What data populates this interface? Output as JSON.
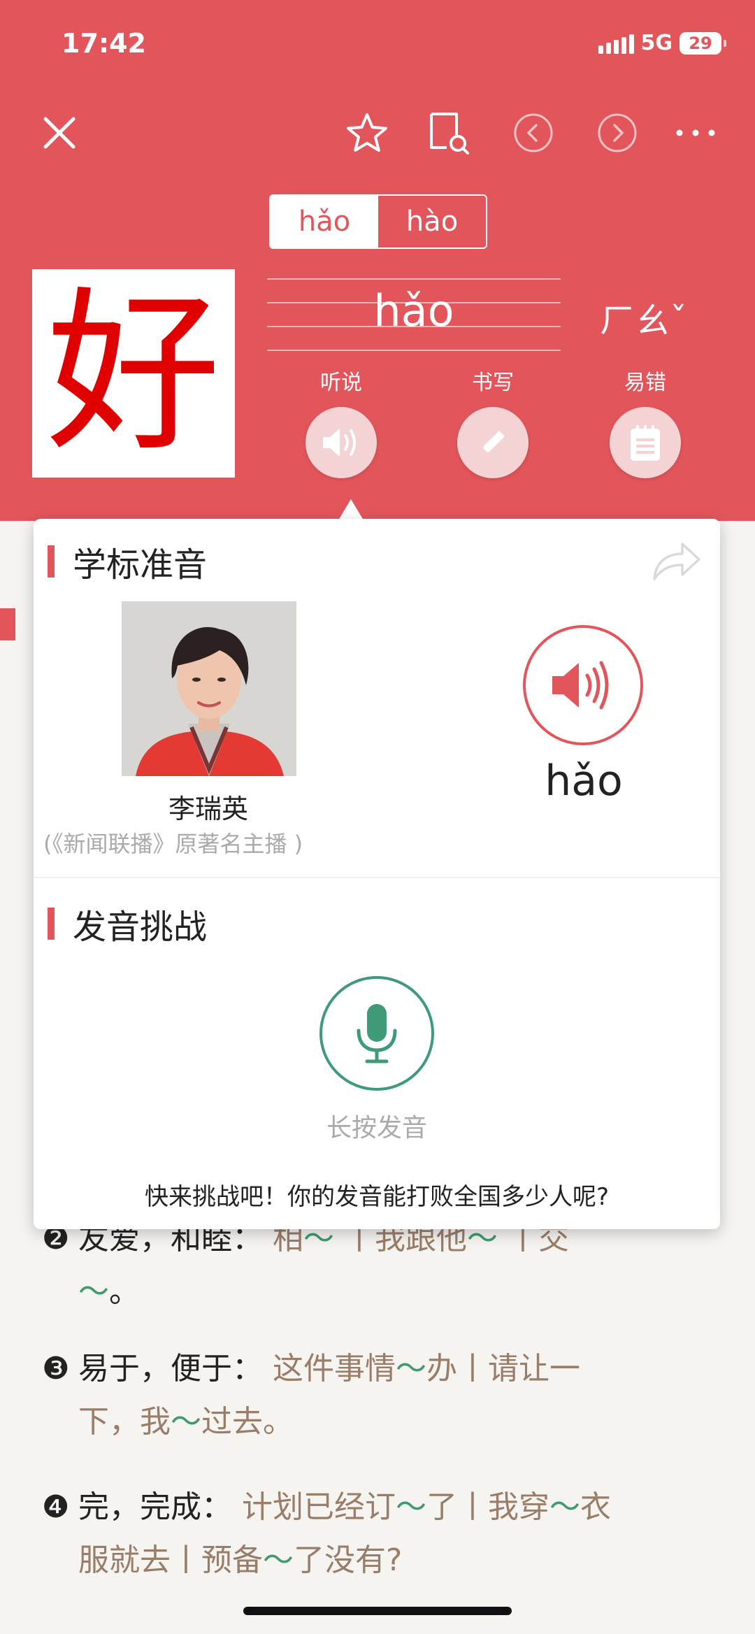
{
  "status_bar": {
    "time": "17:42",
    "network": "5G",
    "battery": "29"
  },
  "toolbar": {
    "close_icon": "close-icon",
    "favorite_icon": "star-icon",
    "book_search_icon": "book-search-icon",
    "prev_icon": "chevron-left-icon",
    "next_icon": "chevron-right-icon",
    "more_icon": "more-icon"
  },
  "tones": [
    {
      "label": "hǎo",
      "selected": true
    },
    {
      "label": "hào",
      "selected": false
    }
  ],
  "character": {
    "glyph": "好",
    "pinyin": "hǎo",
    "zhuyin": "ㄏㄠˇ",
    "color": "#e00000"
  },
  "features": [
    {
      "label": "听说",
      "icon": "speaker-icon"
    },
    {
      "label": "书写",
      "icon": "pencil-icon"
    },
    {
      "label": "易错",
      "icon": "notebook-icon"
    }
  ],
  "popup": {
    "standard_title": "学标准音",
    "anchor_name": "李瑞英",
    "anchor_desc": "(《新闻联播》原著名主播 )",
    "play_pinyin": "hǎo",
    "challenge_title": "发音挑战",
    "mic_label": "长按发音",
    "challenge_text": "快来挑战吧！你的发音能打败全国多少人呢?"
  },
  "definitions": {
    "d2": {
      "num": "❷",
      "gloss": "友爱，和睦：",
      "ex1": "相",
      "ex2": "丨我跟他",
      "ex3": "丨交",
      "ex4": "。"
    },
    "d3": {
      "num": "❸",
      "gloss": "易于，便于：",
      "ex1": "这件事情",
      "ex2": "办丨请让一",
      "ex3": "下，我",
      "ex4": "过去。"
    },
    "d4": {
      "num": "❹",
      "gloss": "完，完成：",
      "ex1": "计划已经订",
      "ex2": "了丨我穿",
      "ex3": "衣",
      "ex4": "服就去丨预备",
      "ex5": "了没有?"
    }
  },
  "colors": {
    "accent": "#e2565b",
    "green": "#3f9a78",
    "example": "#9a7d68"
  }
}
